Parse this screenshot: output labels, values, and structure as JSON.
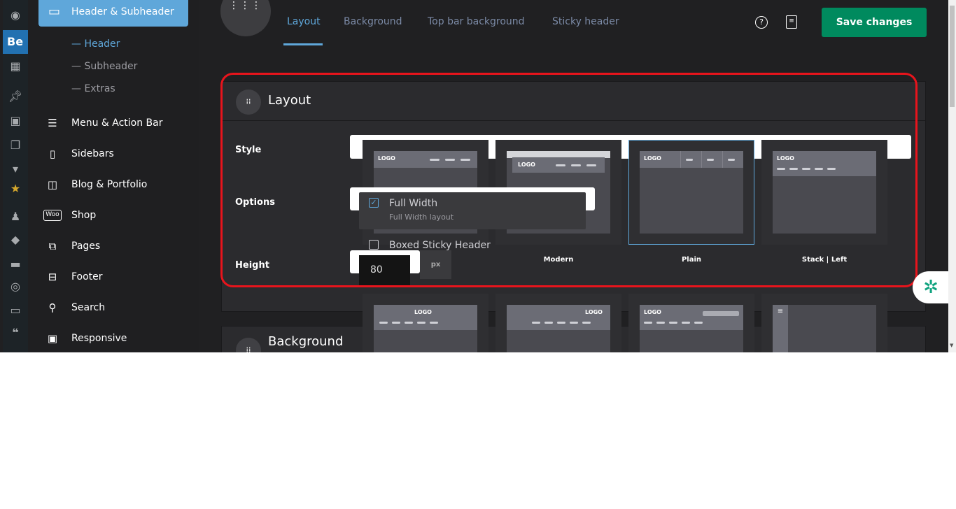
{
  "sidebar": {
    "active": "Header & Subheader",
    "subitems": [
      "Header",
      "Subheader",
      "Extras"
    ],
    "items": [
      {
        "label": "Menu & Action Bar",
        "icon": "menu-icon"
      },
      {
        "label": "Sidebars",
        "icon": "sidebar-icon"
      },
      {
        "label": "Blog & Portfolio",
        "icon": "layout-icon"
      },
      {
        "label": "Shop",
        "icon": "woo-icon",
        "badge": "Woo"
      },
      {
        "label": "Pages",
        "icon": "pages-icon"
      },
      {
        "label": "Footer",
        "icon": "footer-icon"
      },
      {
        "label": "Search",
        "icon": "search-icon"
      },
      {
        "label": "Responsive",
        "icon": "responsive-icon"
      }
    ]
  },
  "adminbar": {
    "brand": "Be"
  },
  "tabs": [
    "Layout",
    "Background",
    "Top bar background",
    "Sticky header"
  ],
  "toolbar": {
    "save_label": "Save changes"
  },
  "layout_panel": {
    "title": "Layout",
    "style_label": "Style",
    "options_label": "Options",
    "height_label": "Height",
    "option_full_width": "Full Width",
    "option_full_width_desc": "Full Width layout",
    "option_full_width_checked": true,
    "option_boxed_sticky": "Boxed Sticky Header",
    "option_boxed_sticky_checked": false,
    "height_value": "80",
    "height_unit": "px",
    "styles": [
      {
        "label": "",
        "logo": "LOGO"
      },
      {
        "label": "Modern",
        "logo": "LOGO"
      },
      {
        "label": "Plain",
        "logo": "LOGO",
        "selected": true
      },
      {
        "label": "Stack | Left",
        "logo": "LOGO"
      }
    ],
    "styles_row2_logo": "LOGO"
  },
  "background_panel": {
    "title": "Background"
  },
  "colors": {
    "accent": "#5fa7da",
    "save": "#008a5e",
    "highlight": "#e8141c"
  }
}
